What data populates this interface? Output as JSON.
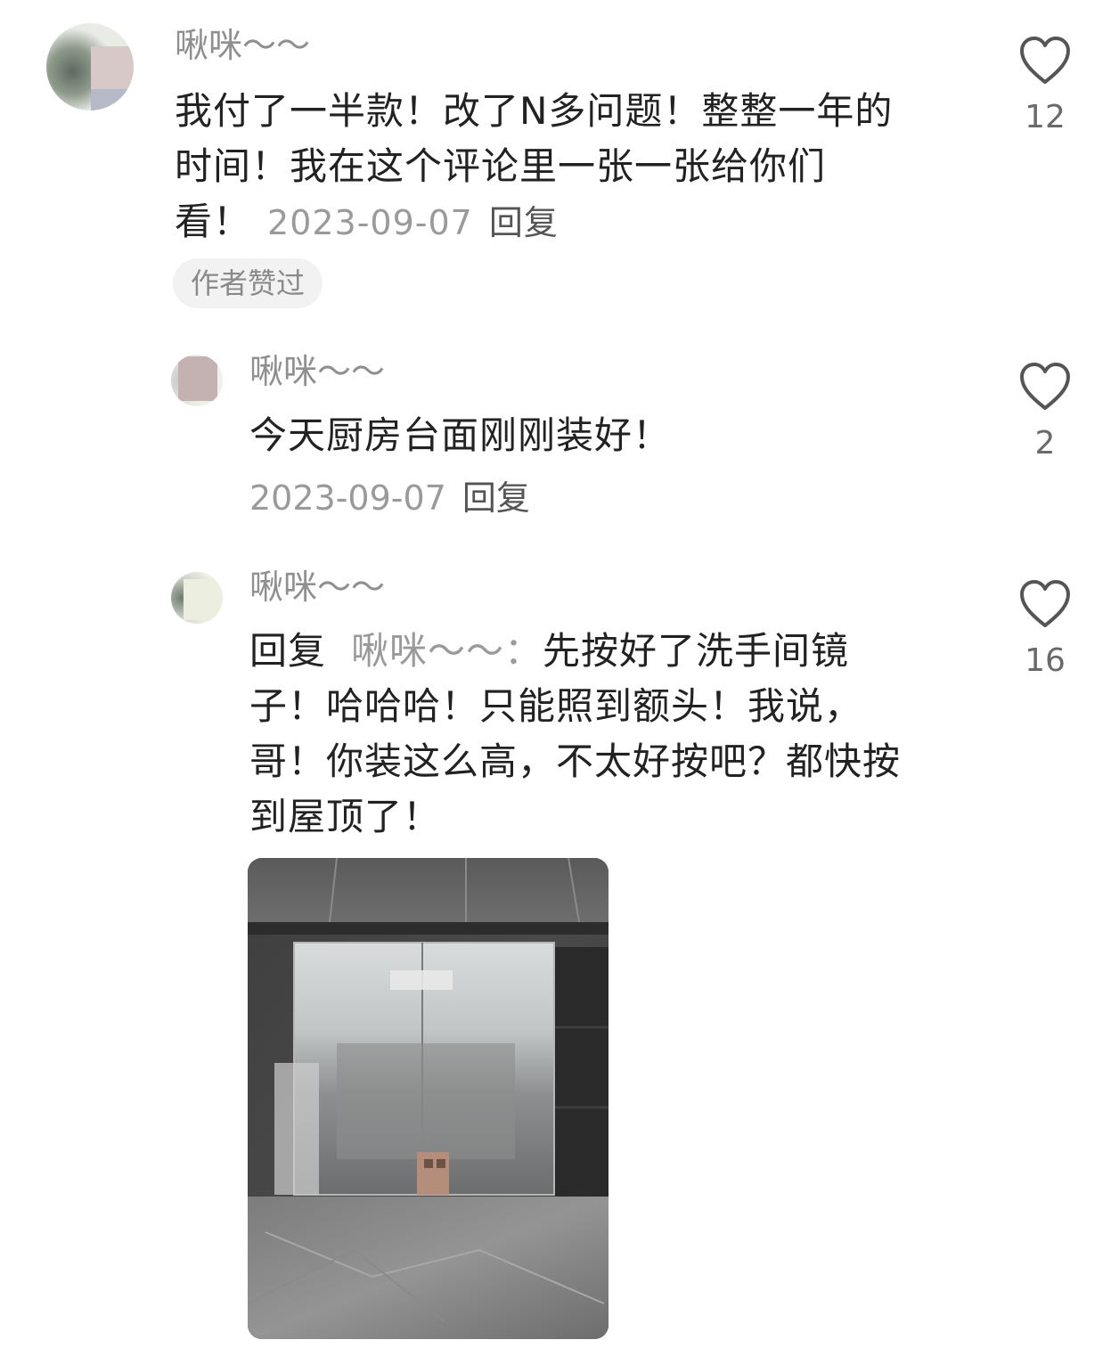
{
  "comments": [
    {
      "username": "啾咪～～",
      "text_lines": [
        "我付了一半款！改了N多问题！整整一年的",
        "时间！我在这个评论里一张一张给你们",
        "看！"
      ],
      "date": "2023-09-07",
      "reply_label": "回复",
      "badge": "作者赞过",
      "likes": "12"
    },
    {
      "username": "啾咪～～",
      "text": "今天厨房台面刚刚装好！",
      "date": "2023-09-07",
      "reply_label": "回复",
      "likes": "2"
    },
    {
      "username": "啾咪～～",
      "reply_prefix": "回复",
      "reply_target": "啾咪～～：",
      "text_lines": [
        "先按好了洗手间镜",
        "子！哈哈哈！只能照到额头！我说，",
        "哥！你装这么高，不太好按吧？都快按",
        "到屋顶了！"
      ],
      "likes": "16"
    }
  ],
  "icons": {
    "like": "heart-outline-icon"
  },
  "colors": {
    "username": "#8f8f8f",
    "text": "#222222",
    "date": "#9a9a9a",
    "badge_bg": "#f2f2f2"
  }
}
